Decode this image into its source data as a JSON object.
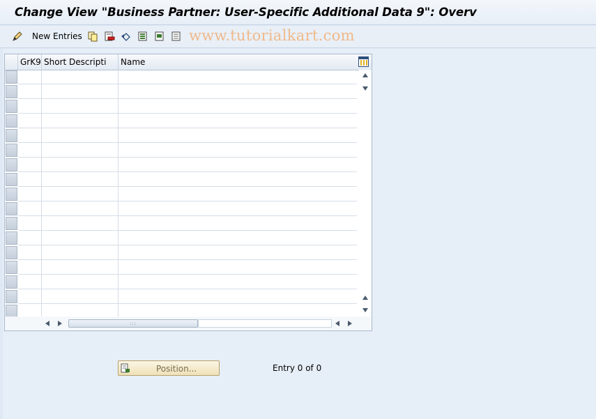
{
  "window": {
    "title": "Change View \"Business Partner: User-Specific Additional Data 9\": Overv"
  },
  "toolbar": {
    "new_entries_label": "New Entries",
    "watermark": "www.tutorialkart.com",
    "icons": [
      "display-change-icon",
      "copy-icon",
      "delete-icon",
      "undo-icon",
      "select-all-icon",
      "select-block-icon",
      "deselect-all-icon"
    ]
  },
  "table": {
    "columns": [
      {
        "key": "grk9",
        "label": "GrK9"
      },
      {
        "key": "short",
        "label": "Short Descripti"
      },
      {
        "key": "name",
        "label": "Name"
      }
    ],
    "row_count": 17,
    "rows": []
  },
  "footer": {
    "position_button": "Position...",
    "entry_status": "Entry 0 of 0"
  },
  "colors": {
    "background": "#dfe9f5",
    "button_face": "#efe2b8",
    "watermark": "#f0b98a"
  }
}
